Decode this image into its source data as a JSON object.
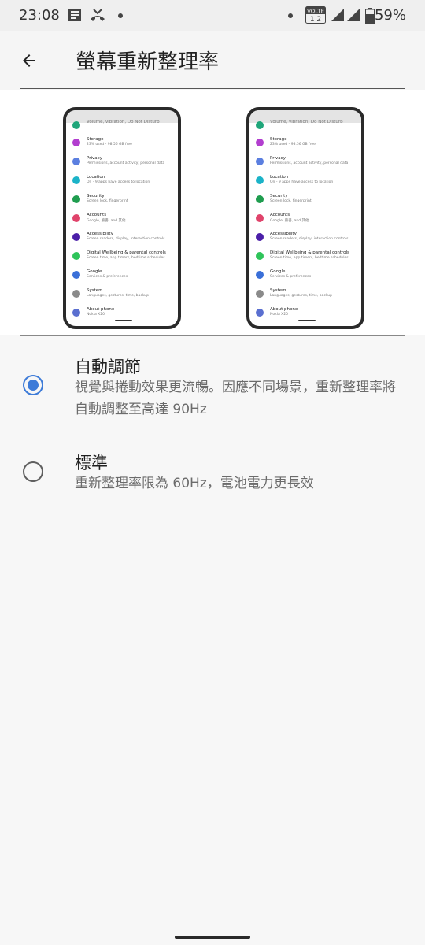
{
  "status_bar": {
    "time": "23:08",
    "battery_percent": "59%",
    "network_badge_top": "VOLTE",
    "network_badge_bottom": "1 2",
    "icons": [
      "news-icon",
      "missed-call-icon",
      "dot-icon",
      "volte-icon",
      "signal-icon",
      "signal-icon",
      "battery-icon"
    ]
  },
  "app_bar": {
    "title": "螢幕重新整理率",
    "back_icon": "arrow-back-icon"
  },
  "preview": {
    "phones": [
      {
        "items": [
          {
            "title": "Volume, vibration, Do Not Disturb",
            "subtitle": "",
            "color": "#1fa67a"
          },
          {
            "title": "Storage",
            "subtitle": "23% used - 98.56 GB free",
            "color": "#b23ecf"
          },
          {
            "title": "Privacy",
            "subtitle": "Permissions, account activity, personal data",
            "color": "#5b7fe0"
          },
          {
            "title": "Location",
            "subtitle": "On - 9 apps have access to location",
            "color": "#1bb3c8"
          },
          {
            "title": "Security",
            "subtitle": "Screen lock, fingerprint",
            "color": "#1f9d4f"
          },
          {
            "title": "Accounts",
            "subtitle": "Google, 臉書, and 其他",
            "color": "#e0436b"
          },
          {
            "title": "Accessibility",
            "subtitle": "Screen readers, display, interaction controls",
            "color": "#4b1fa8"
          },
          {
            "title": "Digital Wellbeing & parental controls",
            "subtitle": "Screen time, app timers, bedtime schedules",
            "color": "#2ec45a"
          },
          {
            "title": "Google",
            "subtitle": "Services & preferences",
            "color": "#3a6fd8"
          },
          {
            "title": "System",
            "subtitle": "Languages, gestures, time, backup",
            "color": "#8a8a8a"
          },
          {
            "title": "About phone",
            "subtitle": "Nokia X20",
            "color": "#5a6fd0"
          }
        ]
      },
      {
        "items": [
          {
            "title": "Volume, vibration, Do Not Disturb",
            "subtitle": "",
            "color": "#1fa67a"
          },
          {
            "title": "Storage",
            "subtitle": "23% used - 98.56 GB free",
            "color": "#b23ecf"
          },
          {
            "title": "Privacy",
            "subtitle": "Permissions, account activity, personal data",
            "color": "#5b7fe0"
          },
          {
            "title": "Location",
            "subtitle": "On - 9 apps have access to location",
            "color": "#1bb3c8"
          },
          {
            "title": "Security",
            "subtitle": "Screen lock, fingerprint",
            "color": "#1f9d4f"
          },
          {
            "title": "Accounts",
            "subtitle": "Google, 臉書, and 其他",
            "color": "#e0436b"
          },
          {
            "title": "Accessibility",
            "subtitle": "Screen readers, display, interaction controls",
            "color": "#4b1fa8"
          },
          {
            "title": "Digital Wellbeing & parental controls",
            "subtitle": "Screen time, app timers, bedtime schedules",
            "color": "#2ec45a"
          },
          {
            "title": "Google",
            "subtitle": "Services & preferences",
            "color": "#3a6fd8"
          },
          {
            "title": "System",
            "subtitle": "Languages, gestures, time, backup",
            "color": "#8a8a8a"
          },
          {
            "title": "About phone",
            "subtitle": "Nokia X20",
            "color": "#5a6fd0"
          }
        ]
      }
    ]
  },
  "options": [
    {
      "title": "自動調節",
      "description": "視覺與捲動效果更流暢。因應不同場景，重新整理率將自動調整至高達 90Hz",
      "selected": true
    },
    {
      "title": "標準",
      "description": "重新整理率限為 60Hz，電池電力更長效",
      "selected": false
    }
  ],
  "colors": {
    "accent": "#3d7bd8",
    "background": "#f7f7f7",
    "preview_background": "#ffffff"
  }
}
